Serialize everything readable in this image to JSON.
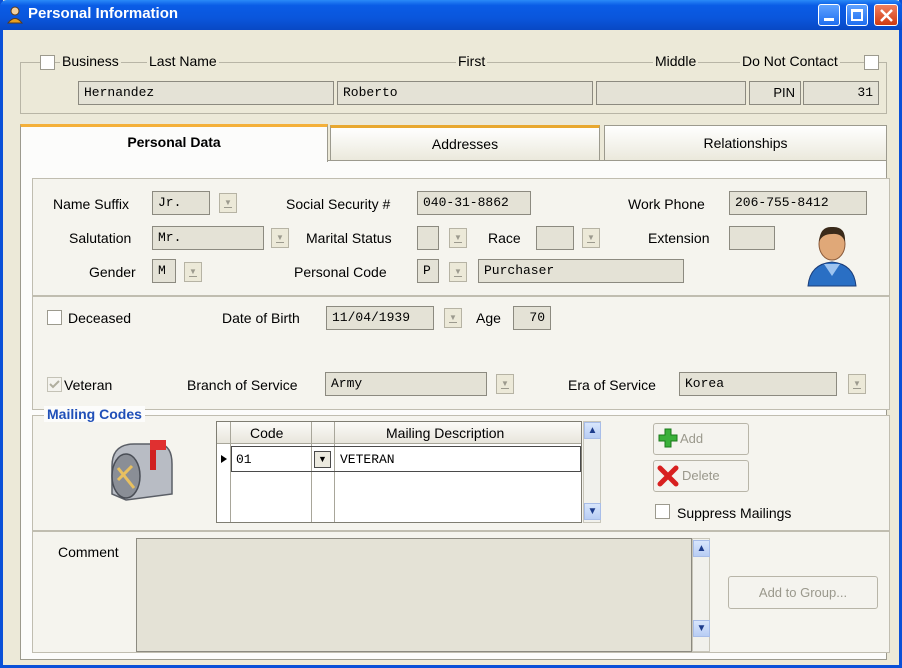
{
  "window": {
    "title": "Personal Information"
  },
  "header": {
    "business_label": "Business",
    "last_name_label": "Last Name",
    "first_label": "First",
    "middle_label": "Middle",
    "do_not_contact_label": "Do Not Contact",
    "last_name": "Hernandez",
    "first_name": "Roberto",
    "middle_name": "",
    "pin_label": "PIN",
    "pin": "31"
  },
  "tabs": {
    "personal_data": "Personal Data",
    "addresses": "Addresses",
    "relationships": "Relationships"
  },
  "personal": {
    "name_suffix_label": "Name Suffix",
    "name_suffix": "Jr.",
    "salutation_label": "Salutation",
    "salutation": "Mr.",
    "gender_label": "Gender",
    "gender": "M",
    "ssn_label": "Social Security #",
    "ssn": "040-31-8862",
    "marital_label": "Marital Status",
    "marital": "",
    "race_label": "Race",
    "race": "",
    "personal_code_label": "Personal Code",
    "personal_code": "P",
    "personal_code_desc": "Purchaser",
    "work_phone_label": "Work Phone",
    "work_phone": "206-755-8412",
    "extension_label": "Extension",
    "extension": ""
  },
  "vitals": {
    "deceased_label": "Deceased",
    "dob_label": "Date of Birth",
    "dob": "11/04/1939",
    "age_label": "Age",
    "age": "70",
    "veteran_label": "Veteran",
    "branch_label": "Branch of Service",
    "branch": "Army",
    "era_label": "Era of Service",
    "era": "Korea"
  },
  "mailing": {
    "section_label": "Mailing Codes",
    "col_code": "Code",
    "col_desc": "Mailing Description",
    "rows": [
      {
        "code": "01",
        "desc": "VETERAN"
      }
    ],
    "add_label": "Add",
    "delete_label": "Delete",
    "suppress_label": "Suppress Mailings"
  },
  "comment": {
    "label": "Comment",
    "value": "",
    "add_to_group_label": "Add to Group..."
  }
}
